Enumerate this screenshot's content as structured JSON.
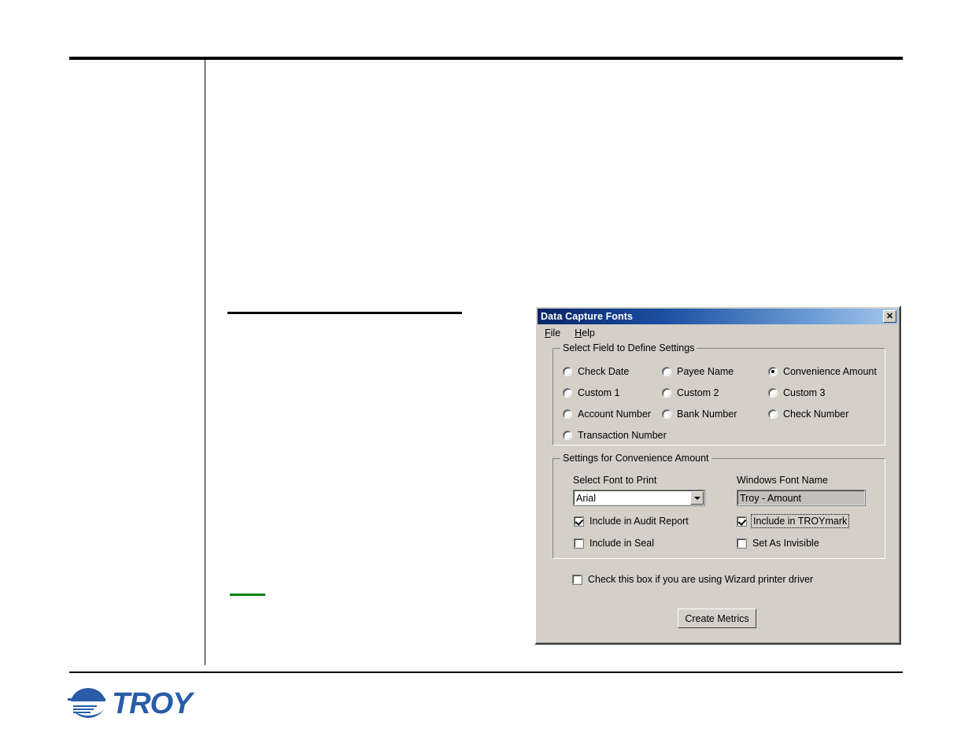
{
  "page": {
    "footer_logo_word": "TROY",
    "logo_color": "#2a5ca8",
    "accent_green": "#00860a"
  },
  "dialog": {
    "title": "Data Capture Fonts",
    "close_label": "✕",
    "menu": [
      {
        "label_before": "",
        "accel": "F",
        "label_after": "ile",
        "name": "file"
      },
      {
        "label_before": "",
        "accel": "H",
        "label_after": "elp",
        "name": "help"
      }
    ],
    "menu_file": "File",
    "menu_help": "Help",
    "select_field_group": {
      "title": "Select Field to Define Settings",
      "options": [
        {
          "label": "Check Date",
          "selected": false
        },
        {
          "label": "Payee Name",
          "selected": false
        },
        {
          "label": "Convenience Amount",
          "selected": true
        },
        {
          "label": "Custom 1",
          "selected": false
        },
        {
          "label": "Custom 2",
          "selected": false
        },
        {
          "label": "Custom 3",
          "selected": false
        },
        {
          "label": "Account Number",
          "selected": false
        },
        {
          "label": "Bank Number",
          "selected": false
        },
        {
          "label": "Check Number",
          "selected": false
        },
        {
          "label": "Transaction Number",
          "selected": false
        }
      ]
    },
    "settings_group": {
      "title": "Settings for Convenience Amount",
      "font_select_label": "Select Font to Print",
      "font_select_value": "Arial",
      "windows_font_label": "Windows Font Name",
      "windows_font_value": "Troy - Amount",
      "checkboxes": [
        {
          "label": "Include in Audit Report",
          "checked": true,
          "focused": false
        },
        {
          "label": "Include in TROYmark",
          "checked": true,
          "focused": true
        },
        {
          "label": "Include in Seal",
          "checked": false,
          "focused": false
        },
        {
          "label": "Set As Invisible",
          "checked": false,
          "focused": false
        }
      ]
    },
    "wizard_checkbox": {
      "label": "Check this box if you are using Wizard printer driver",
      "checked": false
    },
    "create_metrics_button": "Create Metrics"
  }
}
